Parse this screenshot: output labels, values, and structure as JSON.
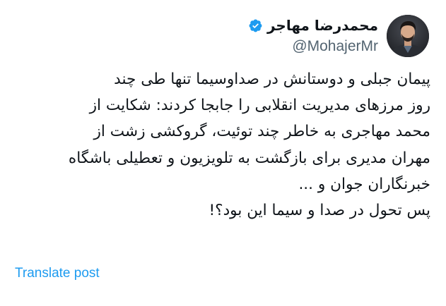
{
  "colors": {
    "text_primary": "#0f1419",
    "text_secondary": "#536471",
    "link": "#1d9bf0",
    "verified": "#1d9bf0"
  },
  "tweet": {
    "author": {
      "display_name": "محمدرضا مهاجر",
      "handle": "@MohajerMr",
      "verified": true,
      "avatar_icon": "profile-photo"
    },
    "more_icon": "more-vertical-icon",
    "text_lines": [
      "پیمان جبلی و دوستانش در صداوسیما تنها طی چند",
      "روز مرزهای مدیریت انقلابی را جابجا کردند: شکایت از",
      "محمد مهاجری به خاطر چند توئیت، گروکشی زشت از",
      "مهران مدیری برای بازگشت به تلویزیون و تعطیلی باشگاه",
      "خبرنگاران جوان و ...",
      "پس تحول در صدا و سیما این بود؟!"
    ],
    "translate_label": "Translate post"
  }
}
